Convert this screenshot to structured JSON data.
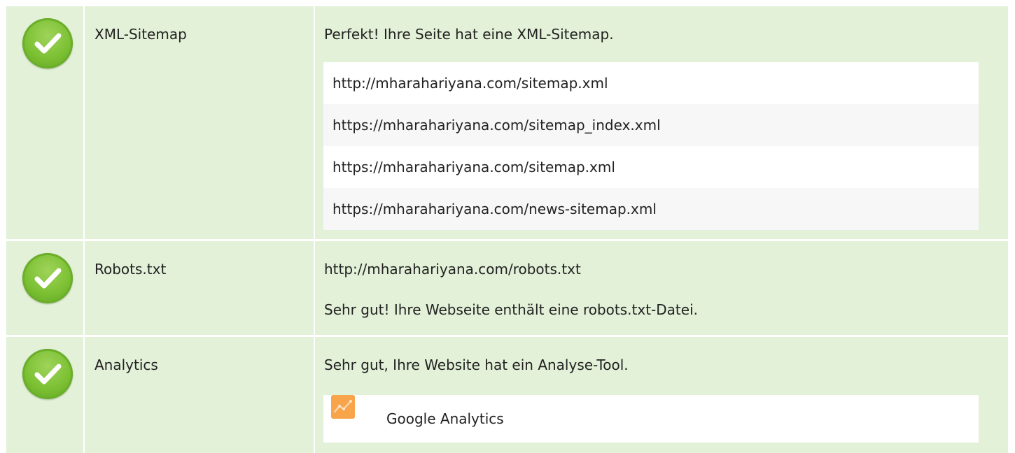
{
  "rows": [
    {
      "name": "XML-Sitemap",
      "message": "Perfekt! Ihre Seite hat eine XML-Sitemap.",
      "sitemaps": [
        "http://mharahariyana.com/sitemap.xml",
        "https://mharahariyana.com/sitemap_index.xml",
        "https://mharahariyana.com/sitemap.xml",
        "https://mharahariyana.com/news-sitemap.xml"
      ]
    },
    {
      "name": "Robots.txt",
      "url": "http://mharahariyana.com/robots.txt",
      "message": "Sehr gut! Ihre Webseite enthält eine robots.txt-Datei."
    },
    {
      "name": "Analytics",
      "message": "Sehr gut, Ihre Website hat ein Analyse-Tool.",
      "tool": "Google Analytics"
    }
  ],
  "icons": {
    "status": "check-icon",
    "tool": "google-analytics-icon"
  },
  "colors": {
    "row_background": "#e3f1d8",
    "check_green": "#7cc033",
    "analytics_orange": "#f7a44a"
  }
}
